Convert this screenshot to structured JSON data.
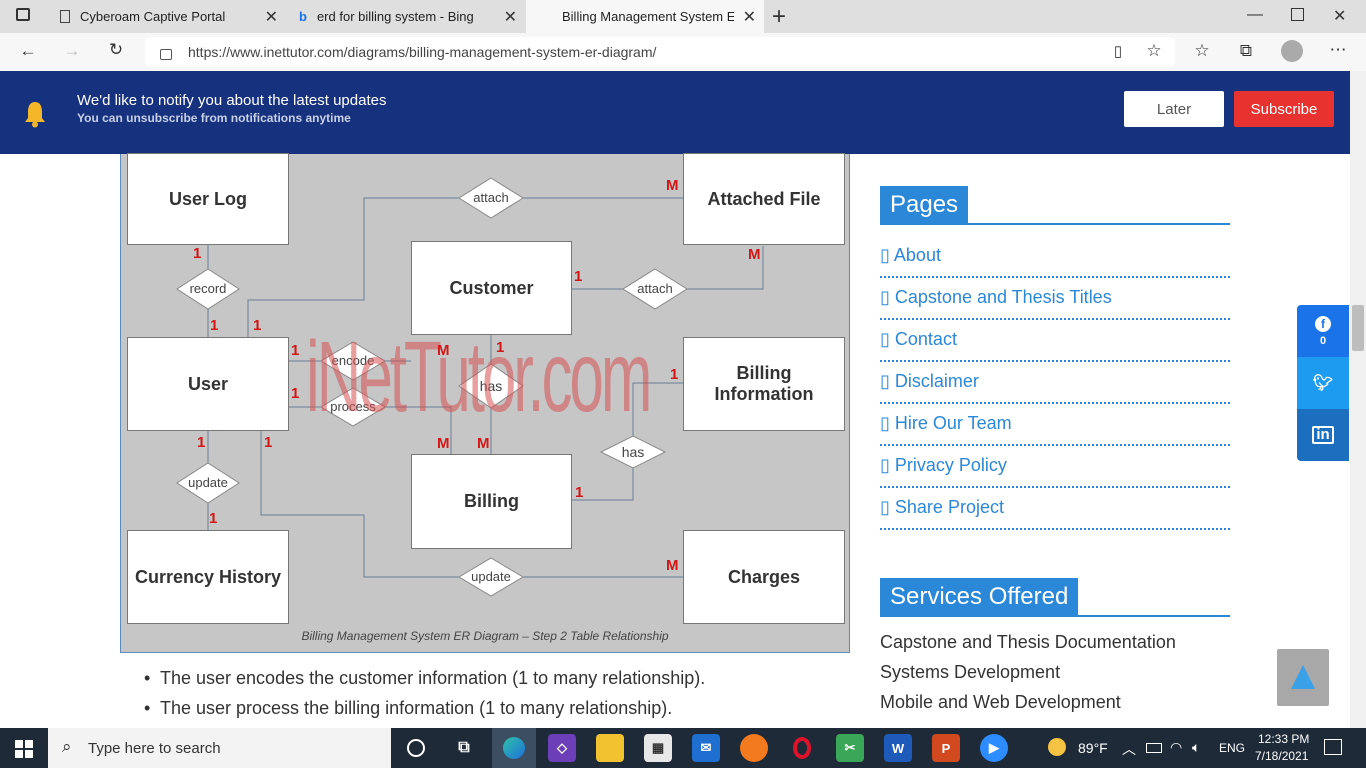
{
  "browser": {
    "tabs": [
      {
        "title": "Cyberoam Captive Portal",
        "active": false
      },
      {
        "title": "erd for billing system - Bing",
        "active": false
      },
      {
        "title": "Billing Management System ER D",
        "active": true
      }
    ],
    "url": "https://www.inettutor.com/diagrams/billing-management-system-er-diagram/",
    "icons": [
      "back-icon",
      "forward-icon",
      "refresh-icon",
      "lock-icon",
      "reader-icon",
      "add-favorite-icon",
      "favorites-icon",
      "collections-icon",
      "profile-icon",
      "more-icon"
    ]
  },
  "notify": {
    "title": "We'd like to notify you about the latest updates",
    "subtitle": "You can unsubscribe from notifications anytime",
    "later": "Later",
    "subscribe": "Subscribe"
  },
  "erd": {
    "entities": {
      "user_log": "User Log",
      "attached_file": "Attached File",
      "customer": "Customer",
      "user": "User",
      "billing_information": "Billing Information",
      "billing": "Billing",
      "currency_history": "Currency History",
      "charges": "Charges"
    },
    "relationships": {
      "attach_top": "attach",
      "attach_right": "attach",
      "record": "record",
      "encode": "encode",
      "has_mid": "has",
      "process": "process",
      "has_right": "has",
      "update_left": "update",
      "update_bottom": "update"
    },
    "cardinality": {
      "one": "1",
      "many": "M"
    },
    "watermark": "iNetTutor.com",
    "caption": "Billing Management System ER Diagram – Step 2 Table Relationship"
  },
  "content": {
    "bullets": [
      "The user encodes the customer information (1 to many relationship).",
      "The user process the billing information (1 to many relationship)."
    ]
  },
  "sidebar": {
    "pages_title": "Pages",
    "pages": [
      "About",
      "Capstone and Thesis Titles",
      "Contact",
      "Disclaimer",
      "Hire Our Team",
      "Privacy Policy",
      "Share Project"
    ],
    "services_title": "Services Offered",
    "services": [
      "Capstone and Thesis Documentation",
      "Systems Development",
      "Mobile and Web Development"
    ]
  },
  "social": {
    "facebook_count": "0"
  },
  "colors": {
    "notify_bg": "#16317d",
    "subscribe": "#e8322f",
    "accent": "#2b88d8",
    "cardinality": "#d21717"
  },
  "taskbar": {
    "search_placeholder": "Type here to search",
    "weather": "89°F",
    "lang": "ENG",
    "time": "12:33 PM",
    "date": "7/18/2021"
  }
}
